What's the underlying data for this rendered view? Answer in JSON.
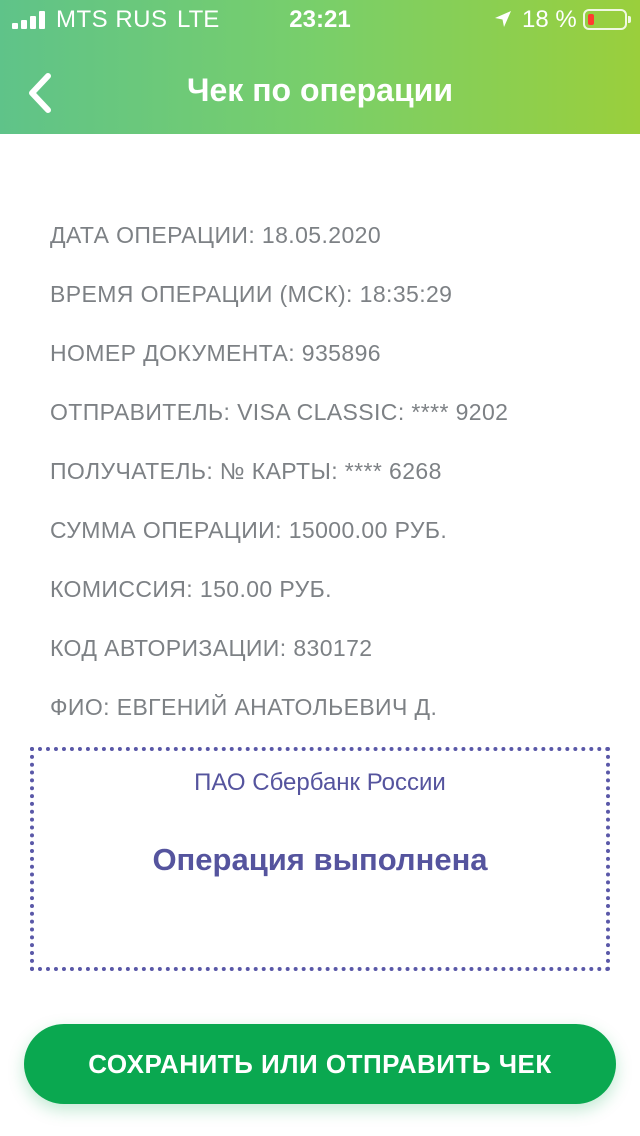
{
  "status_bar": {
    "carrier": "MTS RUS",
    "network": "LTE",
    "time": "23:21",
    "battery_percent": "18 %",
    "battery_level": 0.18,
    "battery_color": "#ff3b30",
    "signal_icon": "signal-bars-icon",
    "location_icon": "location-arrow-icon"
  },
  "nav": {
    "title": "Чек по операции",
    "back_icon": "chevron-left-icon"
  },
  "details": [
    {
      "label": "ДАТА ОПЕРАЦИИ:",
      "value": "18.05.2020"
    },
    {
      "label": "ВРЕМЯ ОПЕРАЦИИ (МСК):",
      "value": "18:35:29"
    },
    {
      "label": "НОМЕР ДОКУМЕНТА:",
      "value": "935896"
    },
    {
      "label": "ОТПРАВИТЕЛЬ:",
      "value": "VISA CLASSIC: **** 9202"
    },
    {
      "label": "ПОЛУЧАТЕЛЬ:",
      "value": "№ КАРТЫ: **** 6268"
    },
    {
      "label": "СУММА ОПЕРАЦИИ:",
      "value": "15000.00 РУБ."
    },
    {
      "label": "КОМИССИЯ:",
      "value": "150.00 РУБ."
    },
    {
      "label": "КОД АВТОРИЗАЦИИ:",
      "value": "830172"
    },
    {
      "label": "ФИО:",
      "value": "ЕВГЕНИЙ АНАТОЛЬЕВИЧ Д."
    }
  ],
  "stamp": {
    "bank": "ПАО Сбербанк России",
    "status": "Операция выполнена",
    "color": "#55549e"
  },
  "actions": {
    "save_label": "СОХРАНИТЬ ИЛИ ОТПРАВИТЬ ЧЕК",
    "accent": "#0aa850"
  }
}
